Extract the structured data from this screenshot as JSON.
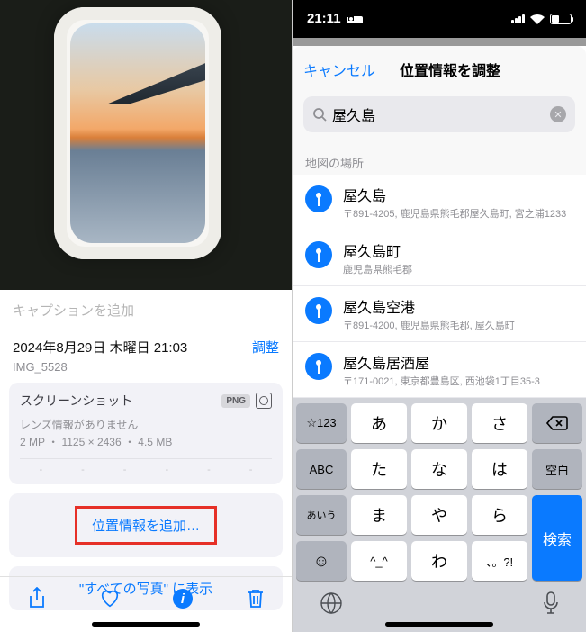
{
  "left": {
    "caption_placeholder": "キャプションを追加",
    "date": "2024年8月29日 木曜日 21:03",
    "adjust": "調整",
    "img_name": "IMG_5528",
    "info_title": "スクリーンショット",
    "png_badge": "PNG",
    "lens_line": "レンズ情報がありません",
    "meta_line": "2 MP ・ 1125 × 2436 ・ 4.5 MB",
    "hist": [
      "-",
      "-",
      "-",
      "-",
      "-",
      "-"
    ],
    "add_location": "位置情報を追加…",
    "show_in_all": "\"すべての写真\" に表示"
  },
  "right": {
    "time": "21:11",
    "cancel": "キャンセル",
    "title": "位置情報を調整",
    "search_value": "屋久島",
    "section": "地図の場所",
    "results": [
      {
        "name": "屋久島",
        "addr": "〒891-4205, 鹿児島県熊毛郡屋久島町, 宮之浦1233"
      },
      {
        "name": "屋久島町",
        "addr": "鹿児島県熊毛郡"
      },
      {
        "name": "屋久島空港",
        "addr": "〒891-4200, 鹿児島県熊毛郡, 屋久島町"
      },
      {
        "name": "屋久島居酒屋",
        "addr": "〒171-0021, 東京都豊島区, 西池袋1丁目35-3"
      }
    ],
    "keys": {
      "r1": [
        "☆123",
        "あ",
        "か",
        "さ"
      ],
      "r2": [
        "ABC",
        "た",
        "な",
        "は",
        "空白"
      ],
      "r3": [
        "あいう",
        "ま",
        "や",
        "ら"
      ],
      "r4": [
        "^_^",
        "わ",
        "、。?!"
      ],
      "search": "検索"
    }
  }
}
